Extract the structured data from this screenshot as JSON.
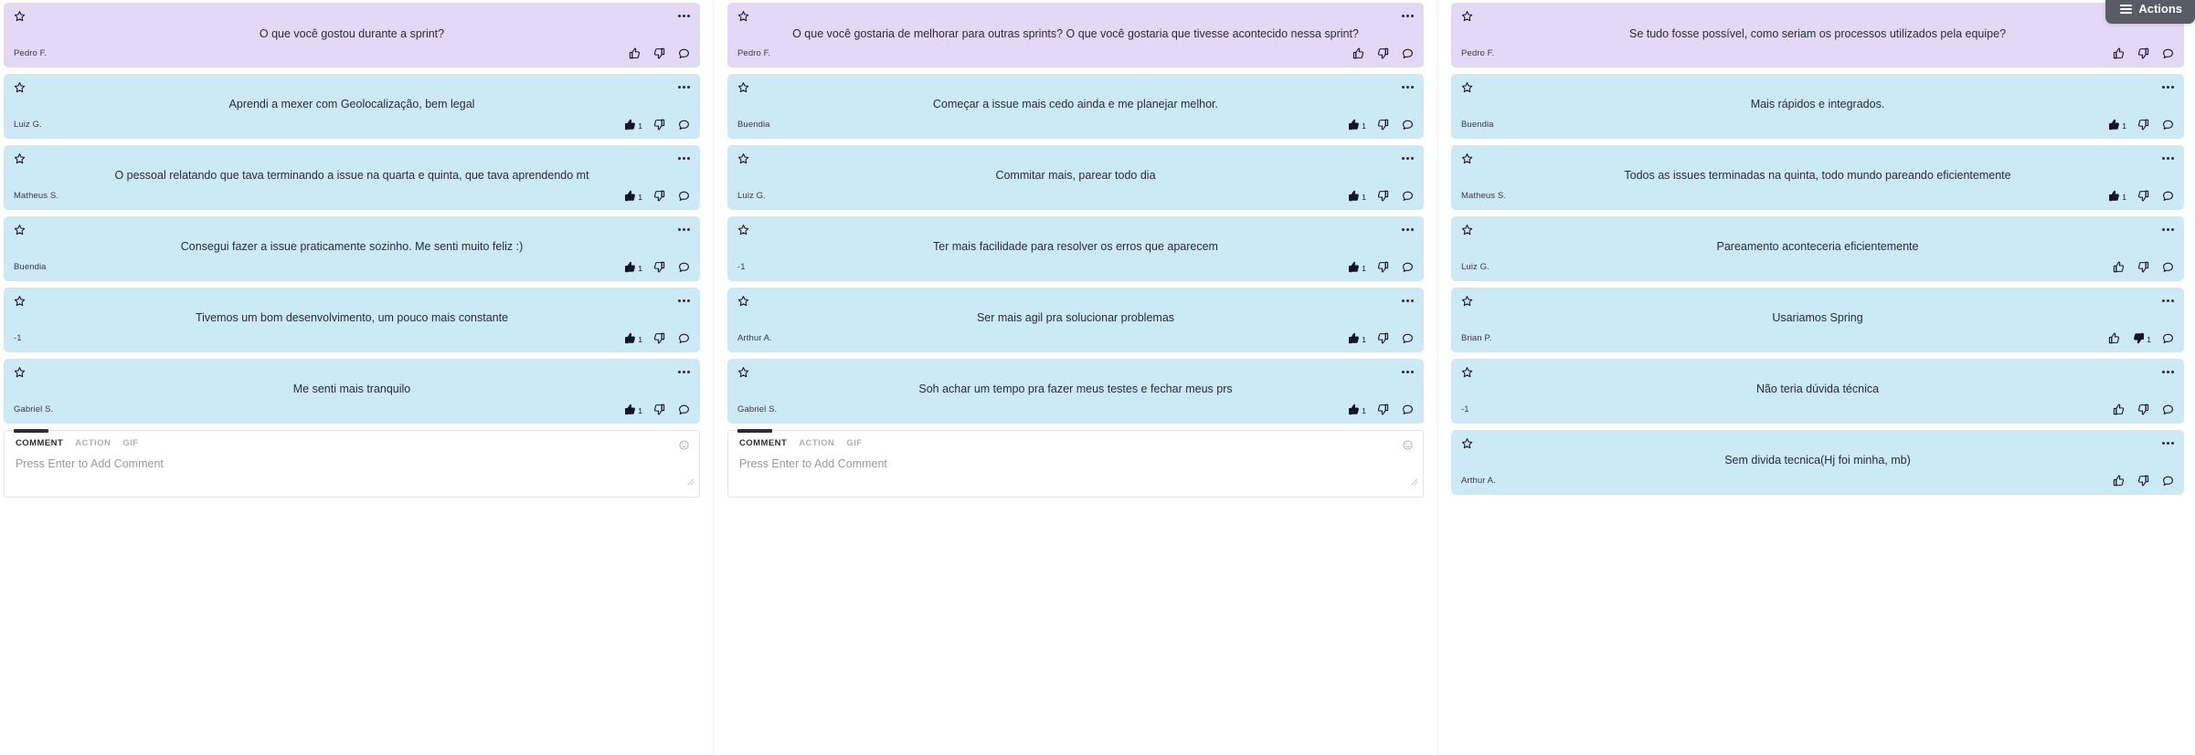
{
  "toolbar": {
    "actions_label": "Actions",
    "menu_icon": "hamburger-icon"
  },
  "colors": {
    "question_card": "#e3d9f7",
    "answer_card": "#cbeaf5",
    "text": "#2b2b3c",
    "actions_button": "#585c67",
    "placeholder": "#9a9aa5"
  },
  "composer": {
    "tabs": [
      "COMMENT",
      "ACTION",
      "GIF"
    ],
    "active_tab": "COMMENT",
    "placeholder": "Press Enter to Add Comment",
    "emoji_icon": "emoji-smiley-icon"
  },
  "columns": [
    {
      "id": "column-liked",
      "has_composer": true,
      "cards": [
        {
          "type": "question",
          "text": "O que você gostou durante a sprint?",
          "author": "Pedro F.",
          "like_count": "",
          "liked": false,
          "dislike_count": "",
          "disliked": false
        },
        {
          "type": "answer",
          "text": "Aprendi a mexer com Geolocalização, bem legal",
          "author": "Luiz G.",
          "like_count": "1",
          "liked": true,
          "dislike_count": "",
          "disliked": false
        },
        {
          "type": "answer",
          "text": "O pessoal relatando que tava terminando a issue na quarta e quinta, que tava aprendendo mt",
          "author": "Matheus S.",
          "like_count": "1",
          "liked": true,
          "dislike_count": "",
          "disliked": false
        },
        {
          "type": "answer",
          "text": "Consegui fazer a issue praticamente sozinho. Me senti muito feliz :)",
          "author": "Buendia",
          "like_count": "1",
          "liked": true,
          "dislike_count": "",
          "disliked": false
        },
        {
          "type": "answer",
          "text": "Tivemos um bom desenvolvimento, um pouco mais constante",
          "author": "-1",
          "like_count": "1",
          "liked": true,
          "dislike_count": "",
          "disliked": false
        },
        {
          "type": "answer",
          "text": "Me senti mais tranquilo",
          "author": "Gabriel S.",
          "like_count": "1",
          "liked": true,
          "dislike_count": "",
          "disliked": false
        }
      ]
    },
    {
      "id": "column-improve",
      "has_composer": true,
      "cards": [
        {
          "type": "question",
          "text": "O que você gostaria de melhorar para outras sprints? O que você gostaria que tivesse acontecido nessa sprint?",
          "author": "Pedro F.",
          "like_count": "",
          "liked": false,
          "dislike_count": "",
          "disliked": false
        },
        {
          "type": "answer",
          "text": "Começar a issue mais cedo ainda e me planejar melhor.",
          "author": "Buendia",
          "like_count": "1",
          "liked": true,
          "dislike_count": "",
          "disliked": false
        },
        {
          "type": "answer",
          "text": "Commitar mais, parear todo dia",
          "author": "Luiz G.",
          "like_count": "1",
          "liked": true,
          "dislike_count": "",
          "disliked": false
        },
        {
          "type": "answer",
          "text": "Ter mais facilidade para resolver os erros que aparecem",
          "author": "-1",
          "like_count": "1",
          "liked": true,
          "dislike_count": "",
          "disliked": false
        },
        {
          "type": "answer",
          "text": "Ser mais agil pra solucionar problemas",
          "author": "Arthur A.",
          "like_count": "1",
          "liked": true,
          "dislike_count": "",
          "disliked": false
        },
        {
          "type": "answer",
          "text": "Soh achar um tempo pra fazer meus testes e fechar meus prs",
          "author": "Gabriel S.",
          "like_count": "1",
          "liked": true,
          "dislike_count": "",
          "disliked": false
        }
      ]
    },
    {
      "id": "column-ideal",
      "has_composer": false,
      "cards": [
        {
          "type": "question",
          "text": "Se tudo fosse possível, como seriam os processos utilizados pela equipe?",
          "author": "Pedro F.",
          "like_count": "",
          "liked": false,
          "dislike_count": "",
          "disliked": false
        },
        {
          "type": "answer",
          "text": "Mais rápidos e integrados.",
          "author": "Buendia",
          "like_count": "1",
          "liked": true,
          "dislike_count": "",
          "disliked": false
        },
        {
          "type": "answer",
          "text": "Todos as issues terminadas na quinta, todo mundo pareando eficientemente",
          "author": "Matheus S.",
          "like_count": "1",
          "liked": true,
          "dislike_count": "",
          "disliked": false
        },
        {
          "type": "answer",
          "text": "Pareamento aconteceria eficientemente",
          "author": "Luiz G.",
          "like_count": "",
          "liked": false,
          "dislike_count": "",
          "disliked": false
        },
        {
          "type": "answer",
          "text": "Usariamos Spring",
          "author": "Brian P.",
          "like_count": "",
          "liked": false,
          "dislike_count": "1",
          "disliked": true
        },
        {
          "type": "answer",
          "text": "Não teria dúvida técnica",
          "author": "-1",
          "like_count": "",
          "liked": false,
          "dislike_count": "",
          "disliked": false
        },
        {
          "type": "answer",
          "text": "Sem divida tecnica(Hj foi minha, mb)",
          "author": "Arthur A.",
          "like_count": "",
          "liked": false,
          "dislike_count": "",
          "disliked": false
        }
      ]
    }
  ]
}
